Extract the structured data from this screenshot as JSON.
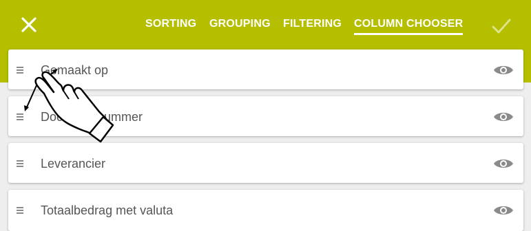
{
  "header": {
    "close_icon": "close-icon",
    "tabs": [
      {
        "label": "SORTING",
        "active": false
      },
      {
        "label": "GROUPING",
        "active": false
      },
      {
        "label": "FILTERING",
        "active": false
      },
      {
        "label": "COLUMN CHOOSER",
        "active": true
      }
    ],
    "confirm_icon": "checkmark-icon"
  },
  "columns": [
    {
      "label": "Gemaakt op",
      "visible": true
    },
    {
      "label": "Documentnummer",
      "visible": true
    },
    {
      "label": "Leverancier",
      "visible": true
    },
    {
      "label": "Totaalbedrag met valuta",
      "visible": true
    }
  ],
  "colors": {
    "accent": "#b5bf00",
    "background": "#eeeeee",
    "card": "#ffffff",
    "text": "#555555",
    "icon": "#8a8a8a"
  }
}
